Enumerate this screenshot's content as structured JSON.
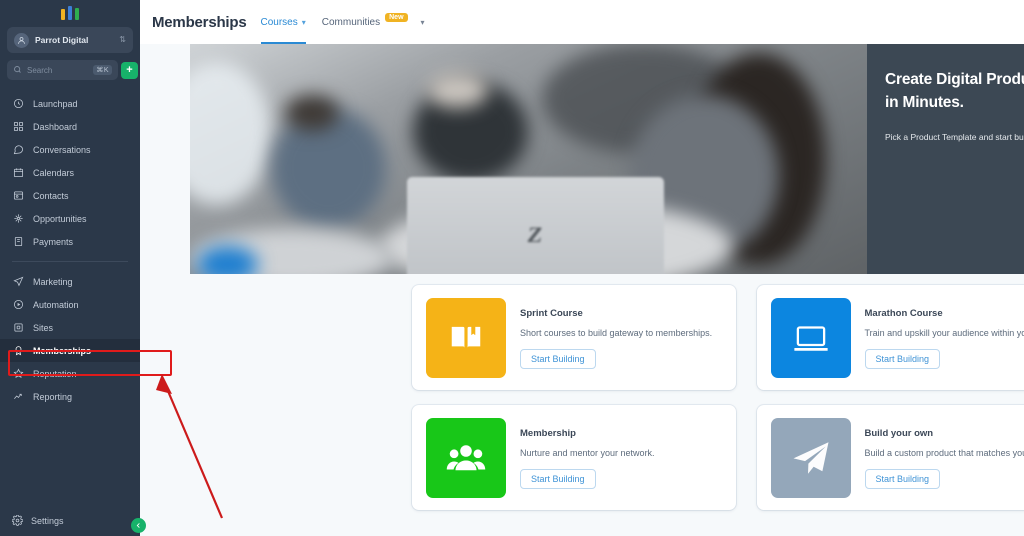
{
  "sidebar": {
    "logo_name": "app-logo-bars",
    "workspace": {
      "name": "Parrot Digital",
      "avatar_icon": "workspace-avatar-icon",
      "caret_icon": "updown-caret-icon"
    },
    "search": {
      "placeholder": "Search",
      "shortcut": "⌘K",
      "icon": "search-icon",
      "add_label": "+"
    },
    "items": [
      {
        "label": "Launchpad",
        "icon": "rocket-icon"
      },
      {
        "label": "Dashboard",
        "icon": "dashboard-grid-icon"
      },
      {
        "label": "Conversations",
        "icon": "chat-bubble-icon"
      },
      {
        "label": "Calendars",
        "icon": "calendar-icon"
      },
      {
        "label": "Contacts",
        "icon": "contacts-card-icon"
      },
      {
        "label": "Opportunities",
        "icon": "opportunities-node-icon"
      },
      {
        "label": "Payments",
        "icon": "payments-icon"
      }
    ],
    "items2": [
      {
        "label": "Marketing",
        "icon": "paper-plane-icon"
      },
      {
        "label": "Automation",
        "icon": "play-circle-icon"
      },
      {
        "label": "Sites",
        "icon": "sites-icon"
      },
      {
        "label": "Memberships",
        "icon": "badge-ribbon-icon"
      },
      {
        "label": "Reputation",
        "icon": "star-icon"
      },
      {
        "label": "Reporting",
        "icon": "trend-line-icon"
      }
    ],
    "active_item": "Memberships",
    "settings": {
      "label": "Settings",
      "icon": "gear-icon"
    },
    "collapse": {
      "icon": "chevron-left-icon"
    }
  },
  "topbar": {
    "title": "Memberships",
    "tabs": [
      {
        "label": "Courses",
        "active": true,
        "caret_icon": "chevron-down-icon",
        "badge": ""
      },
      {
        "label": "Communities",
        "active": false,
        "caret_icon": "chevron-down-icon",
        "badge": "New"
      }
    ]
  },
  "hero": {
    "heading_line1": "Create Digital Products",
    "heading_line2": "in Minutes.",
    "subtext": "Pick a Product Template and start building!",
    "image_alt": "office-team-laptop-photo"
  },
  "cards": [
    {
      "title": "Sprint Course",
      "desc": "Short courses to build gateway to memberships.",
      "button": "Start Building",
      "tile_color": "#f5b317",
      "icon": "open-book-icon"
    },
    {
      "title": "Marathon Course",
      "desc": "Train and upskill your audience within your niche.",
      "button": "Start Building",
      "tile_color": "#0c86e0",
      "icon": "laptop-icon"
    },
    {
      "title": "Membership",
      "desc": "Nurture and mentor your network.",
      "button": "Start Building",
      "tile_color": "#16c game",
      "icon": "people-group-icon"
    },
    {
      "title": "Build your own",
      "desc": "Build a custom product that matches your content.",
      "button": "Start Building",
      "tile_color": "#94a7ba",
      "icon": "paper-plane-icon"
    }
  ],
  "card_tile_colors": [
    "#f5b317",
    "#0c86e0",
    "#18c718",
    "#94a7ba"
  ],
  "annotations": {
    "highlight_target": "Memberships",
    "highlight_color": "#e01b1b",
    "arrow_color": "#cc1b1b"
  },
  "theme": {
    "sidebar_bg": "#2b3849",
    "accent_blue": "#2a8ad4",
    "badge_amber": "#f0b323",
    "page_bg": "#f6f9fb",
    "hero_panel_bg": "#3c4854"
  }
}
